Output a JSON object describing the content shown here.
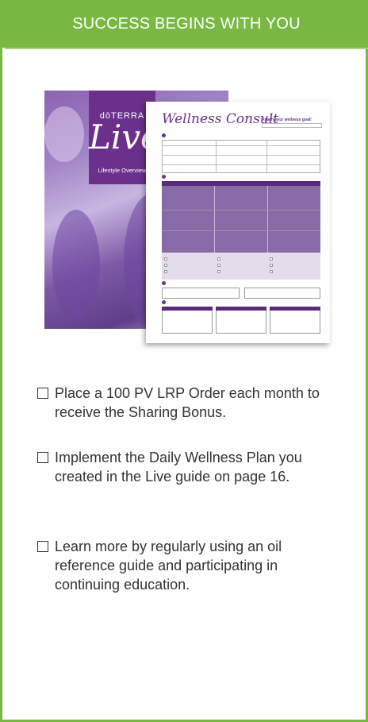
{
  "banner": {
    "title": "SUCCESS BEGINS WITH YOU"
  },
  "booklet": {
    "brand": "dōTERRA",
    "title": "Live",
    "subtitle": "Lifestyle Overview"
  },
  "worksheet": {
    "title": "Wellness Consult",
    "goal_label": "Reach your wellness goal!"
  },
  "checklist": [
    {
      "text": "Place a 100 PV LRP Order each month to receive the Sharing Bonus."
    },
    {
      "text": "Implement the Daily Wellness Plan you created in the Live guide on page 16."
    },
    {
      "text": "Learn more by regularly using an oil reference guide and participating in continuing education."
    }
  ],
  "colors": {
    "accent_green": "#79b843",
    "brand_purple": "#6b2f8c",
    "text": "#333333"
  }
}
